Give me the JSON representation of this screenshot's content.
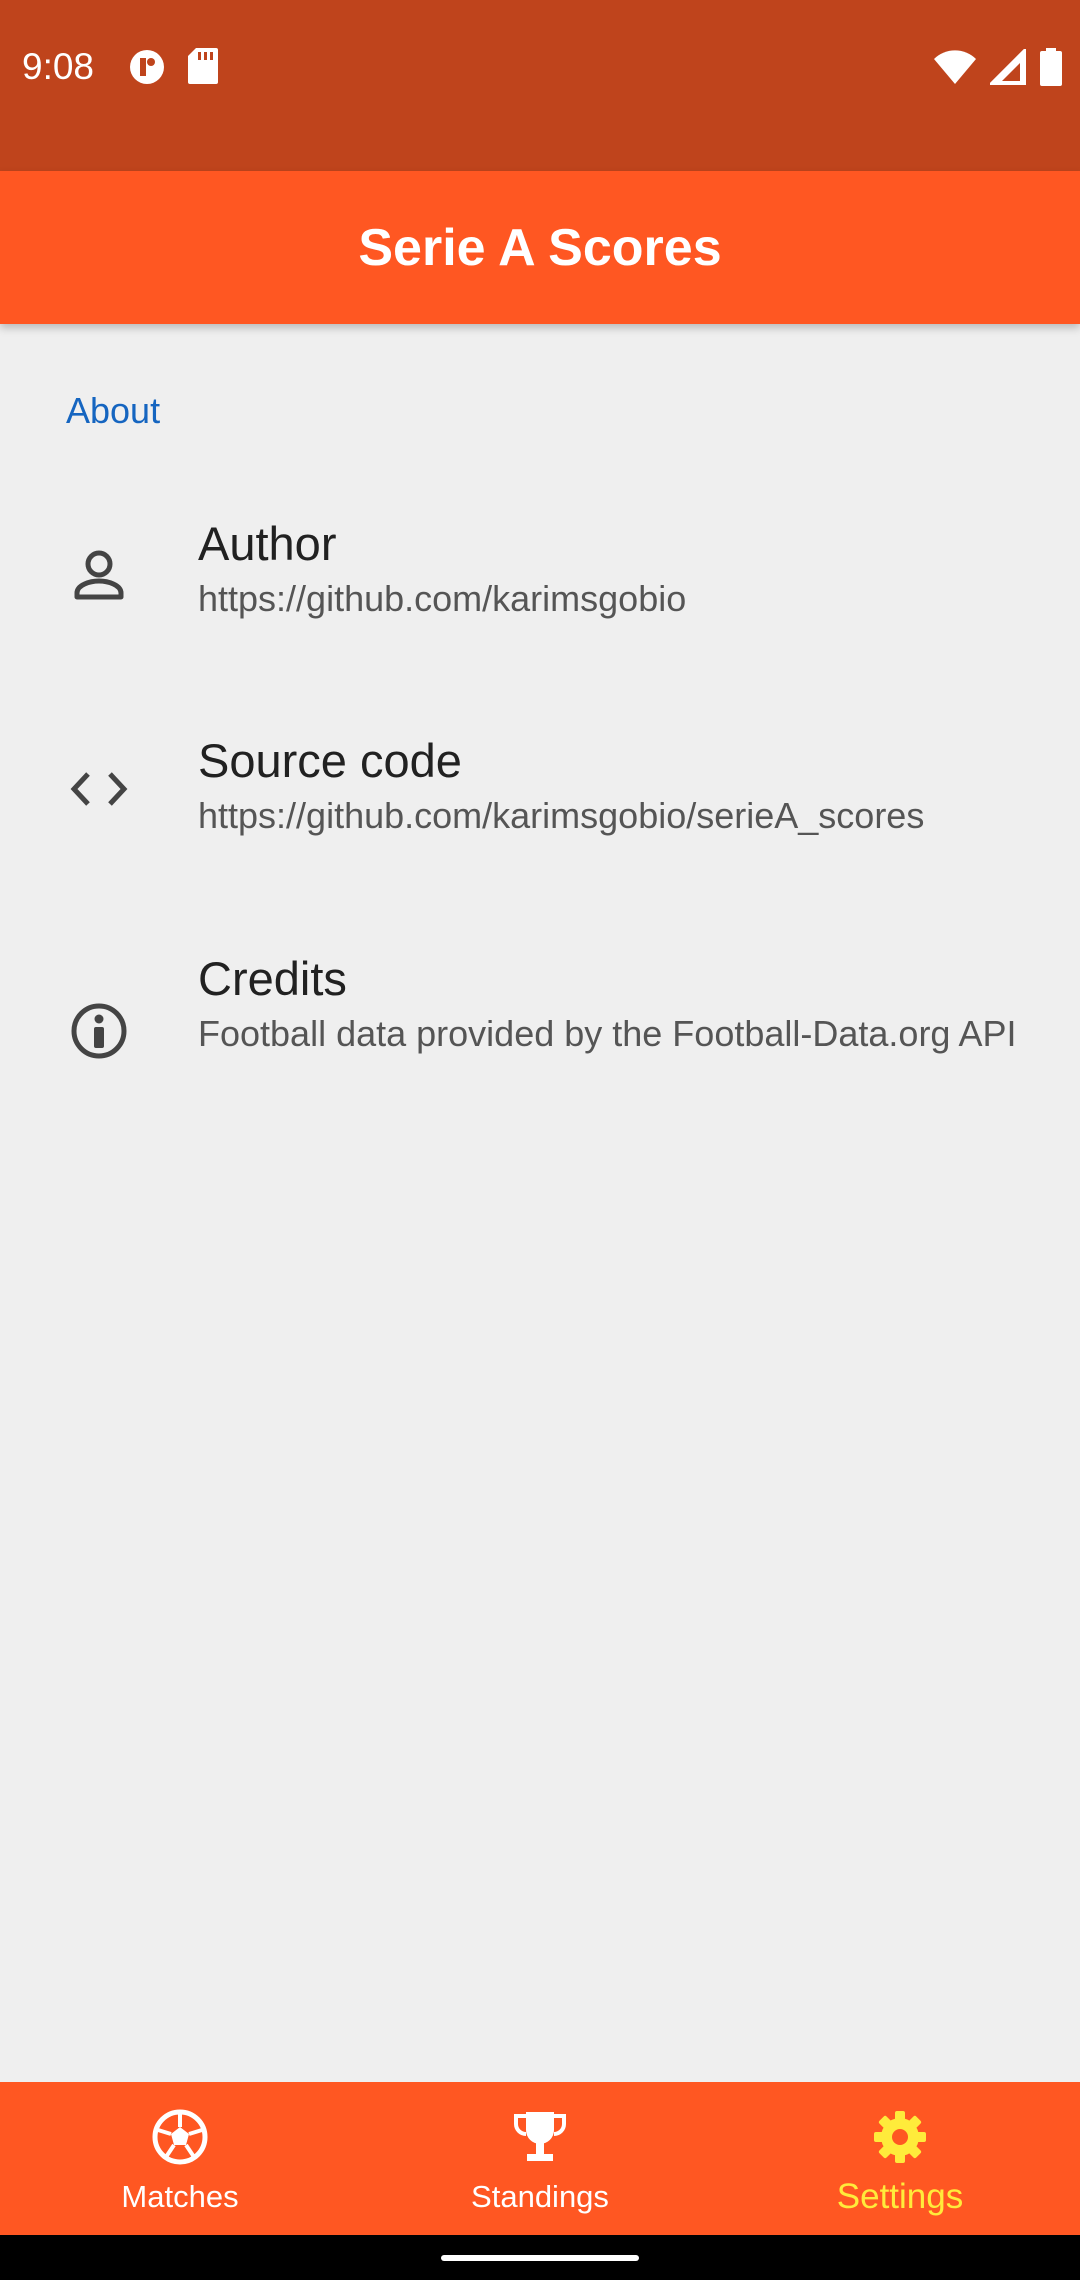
{
  "status_bar": {
    "time": "9:08",
    "left_icons": [
      "privacy-icon",
      "sd-card-icon"
    ],
    "right_icons": [
      "wifi-icon",
      "signal-icon",
      "battery-icon"
    ]
  },
  "app_bar": {
    "title": "Serie A Scores"
  },
  "section": {
    "header": "About"
  },
  "items": [
    {
      "icon": "person-icon",
      "title": "Author",
      "subtitle": "https://github.com/karimsgobio"
    },
    {
      "icon": "code-icon",
      "title": "Source code",
      "subtitle": "https://github.com/karimsgobio/serieA_scores"
    },
    {
      "icon": "info-icon",
      "title": "Credits",
      "subtitle": "Football data provided by the Football-Data.org API"
    }
  ],
  "bottom_nav": {
    "items": [
      {
        "label": "Matches",
        "icon": "soccer-ball-icon",
        "active": false
      },
      {
        "label": "Standings",
        "icon": "trophy-icon",
        "active": false
      },
      {
        "label": "Settings",
        "icon": "gear-icon",
        "active": true
      }
    ]
  },
  "colors": {
    "status_bar": "#BF441C",
    "primary": "#FF5722",
    "background": "#EFEFEF",
    "section_header": "#1565C0",
    "active_nav": "#FFEB3B"
  }
}
